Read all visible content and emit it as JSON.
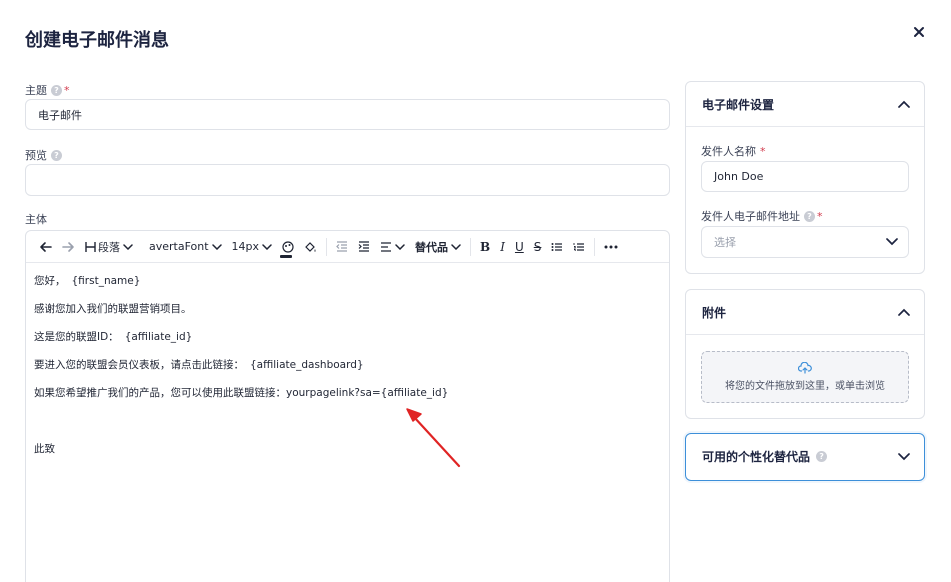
{
  "dialog": {
    "title": "创建电子邮件消息"
  },
  "subject": {
    "label": "主题",
    "value": "电子邮件"
  },
  "preview": {
    "label": "预览",
    "value": ""
  },
  "body": {
    "label": "主体",
    "toolbar": {
      "heading_label": "段落",
      "font_label": "avertaFont",
      "size_label": "14px",
      "merge_label": "替代品"
    },
    "lines": [
      {
        "text": "您好，",
        "var": "{first_name}"
      },
      {
        "text": "感谢您加入我们的联盟营销项目。",
        "var": ""
      },
      {
        "text": "这是您的联盟ID：",
        "var": "{affiliate_id}"
      },
      {
        "text": "要进入您的联盟会员仪表板，请点击此链接：",
        "var": "{affiliate_dashboard}"
      },
      {
        "text": "如果您希望推广我们的产品，您可以使用此联盟链接：yourpagelink?sa={affiliate_id}",
        "var": ""
      },
      {
        "text": "",
        "var": ""
      },
      {
        "text": "此致",
        "var": ""
      }
    ]
  },
  "email_settings": {
    "title": "电子邮件设置",
    "sender_name_label": "发件人名称",
    "sender_name_value": "John Doe",
    "sender_email_label": "发件人电子邮件地址",
    "sender_email_placeholder": "选择"
  },
  "attachments": {
    "title": "附件",
    "dropzone_text": "将您的文件拖放到这里，或单击浏览"
  },
  "substitutions": {
    "title": "可用的个性化替代品"
  },
  "colors": {
    "accent": "#3d8fd9",
    "arrow": "#e02424",
    "required": "#d23a4c"
  }
}
